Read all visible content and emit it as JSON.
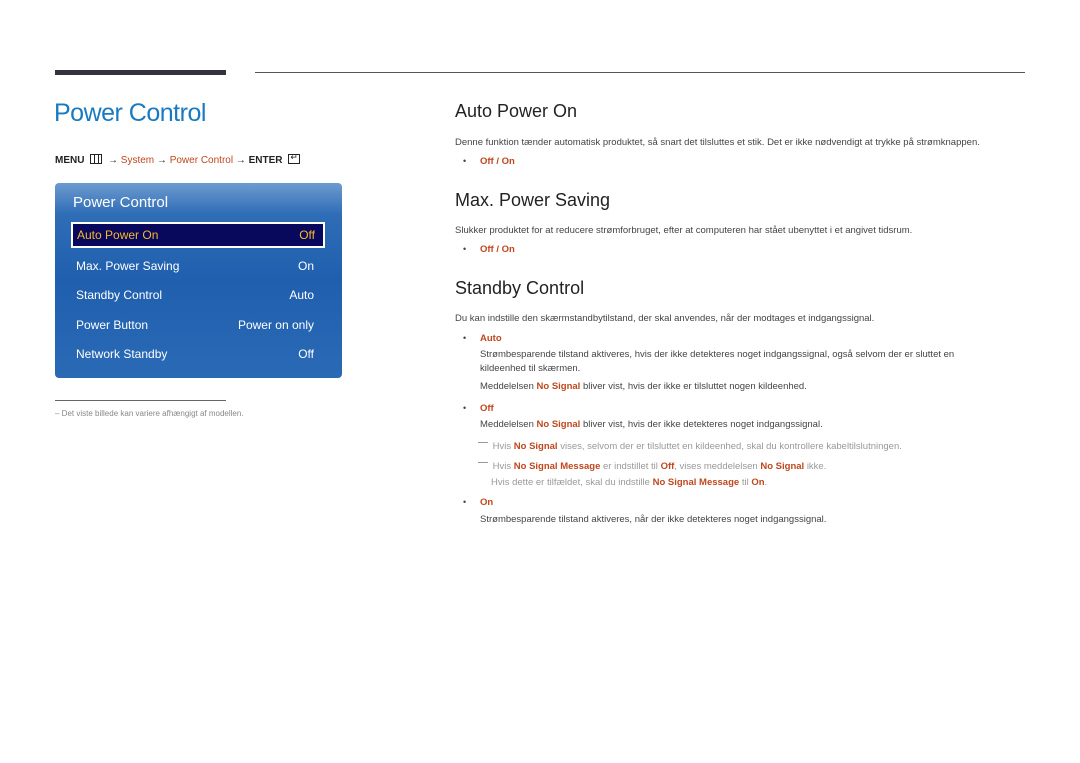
{
  "page_title": "Power Control",
  "menu_path": {
    "menu": "MENU",
    "arrow": "→",
    "system": "System",
    "power_control": "Power Control",
    "enter": "ENTER"
  },
  "osd": {
    "title": "Power Control",
    "rows": [
      {
        "label": "Auto Power On",
        "value": "Off",
        "selected": true
      },
      {
        "label": "Max. Power Saving",
        "value": "On"
      },
      {
        "label": "Standby Control",
        "value": "Auto"
      },
      {
        "label": "Power Button",
        "value": "Power on only"
      },
      {
        "label": "Network Standby",
        "value": "Off"
      }
    ]
  },
  "footnote": "Det viste billede kan variere afhængigt af modellen.",
  "sections": {
    "auto_power_on": {
      "title": "Auto Power On",
      "desc": "Denne funktion tænder automatisk produktet, så snart det tilsluttes et stik. Det er ikke nødvendigt at trykke på strømknappen.",
      "options": "Off / On"
    },
    "max_power_saving": {
      "title": "Max. Power Saving",
      "desc": "Slukker produktet for at reducere strømforbruget, efter at computeren har stået ubenyttet i et angivet tidsrum.",
      "options": "Off / On"
    },
    "standby_control": {
      "title": "Standby Control",
      "desc": "Du kan indstille den skærmstandbytilstand, der skal anvendes, når der modtages et indgangssignal.",
      "auto": {
        "label": "Auto",
        "line1": "Strømbesparende tilstand aktiveres, hvis der ikke detekteres noget indgangssignal, også selvom der er sluttet en",
        "line2": "kildeenhed til skærmen.",
        "msg_pre": "Meddelelsen",
        "msg_key": "No Signal",
        "msg_post": "bliver vist, hvis der ikke er tilsluttet nogen kildeenhed."
      },
      "off": {
        "label": "Off",
        "msg_pre": "Meddelelsen",
        "msg_key": "No Signal",
        "msg_post": "bliver vist, hvis der ikke detekteres noget indgangssignal.",
        "note1_pre": "Hvis",
        "note1_key": "No Signal",
        "note1_post": "vises, selvom der er tilsluttet en kildeenhed, skal du kontrollere kabeltilslutningen.",
        "note2_pre": "Hvis",
        "note2_key1": "No Signal Message",
        "note2_mid1": "er indstillet til",
        "note2_key2": "Off",
        "note2_mid2": ", vises meddelelsen",
        "note2_key3": "No Signal",
        "note2_post": "ikke.",
        "note3_pre": "Hvis dette er tilfældet, skal du indstille",
        "note3_key1": "No Signal Message",
        "note3_mid": "til",
        "note3_key2": "On",
        "note3_post": "."
      },
      "on": {
        "label": "On",
        "line1": "Strømbesparende tilstand aktiveres, når der ikke detekteres noget indgangssignal."
      }
    }
  }
}
